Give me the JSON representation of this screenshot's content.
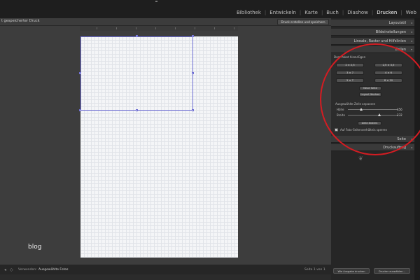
{
  "modules": [
    {
      "label": "Bibliothek",
      "active": false
    },
    {
      "label": "Entwickeln",
      "active": false
    },
    {
      "label": "Karte",
      "active": false
    },
    {
      "label": "Buch",
      "active": false
    },
    {
      "label": "Diashow",
      "active": false
    },
    {
      "label": "Drucken",
      "active": true
    },
    {
      "label": "Web",
      "active": false
    }
  ],
  "toolbar": {
    "doc_title": "t gespeicherter Druck",
    "create_button": "Druck erstellen und speichern"
  },
  "canvas": {
    "watermark": "blog"
  },
  "bottombar": {
    "source_label": "Verwenden:",
    "source_value": "Ausgewählte Fotos",
    "page_indicator": "Seite 1 von 1"
  },
  "panels": {
    "layoutstil": "Layoutstil",
    "bildeinstellungen": "Bildeinstellungen",
    "lineale": "Lineale, Raster und Hilfslinien",
    "zellen": "Zellen",
    "seite": "Seite",
    "druckauftrag": "Druckauftrag"
  },
  "zellen": {
    "add_to_package": "Dem Paket hinzufügen",
    "sizes": [
      "2 × 2,5",
      "2,5 × 3,5",
      "3 × 7",
      "4 × 6",
      "5 × 7",
      "8 × 10"
    ],
    "new_page": "Neue Seite",
    "auto_layout": "Layout löschen",
    "selected_cell_caption": "Ausgewählte Zelle anpassen",
    "height_label": "Höhe",
    "height_value": "156",
    "width_label": "Breite",
    "width_value": "232",
    "edit_button": "Zelle ändern",
    "lock_label": "Auf Foto-Seitenverhältnis sperren",
    "lock_checked": true
  },
  "right_buttons": {
    "print_to_file": "Wie Ausgabe drucken",
    "printer": "Drucker auswählen..."
  },
  "colors": {
    "selection": "#6e6ed2",
    "annotation": "#d41c22"
  }
}
